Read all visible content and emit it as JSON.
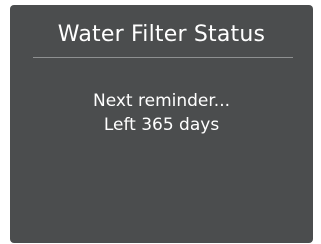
{
  "screen": {
    "title": "Water Filter Status",
    "message_line1": "Next reminder...",
    "message_line2": "Left 365 days"
  },
  "colors": {
    "background": "#4b4d4e",
    "text": "#ffffff",
    "divider": "#8e9091"
  }
}
